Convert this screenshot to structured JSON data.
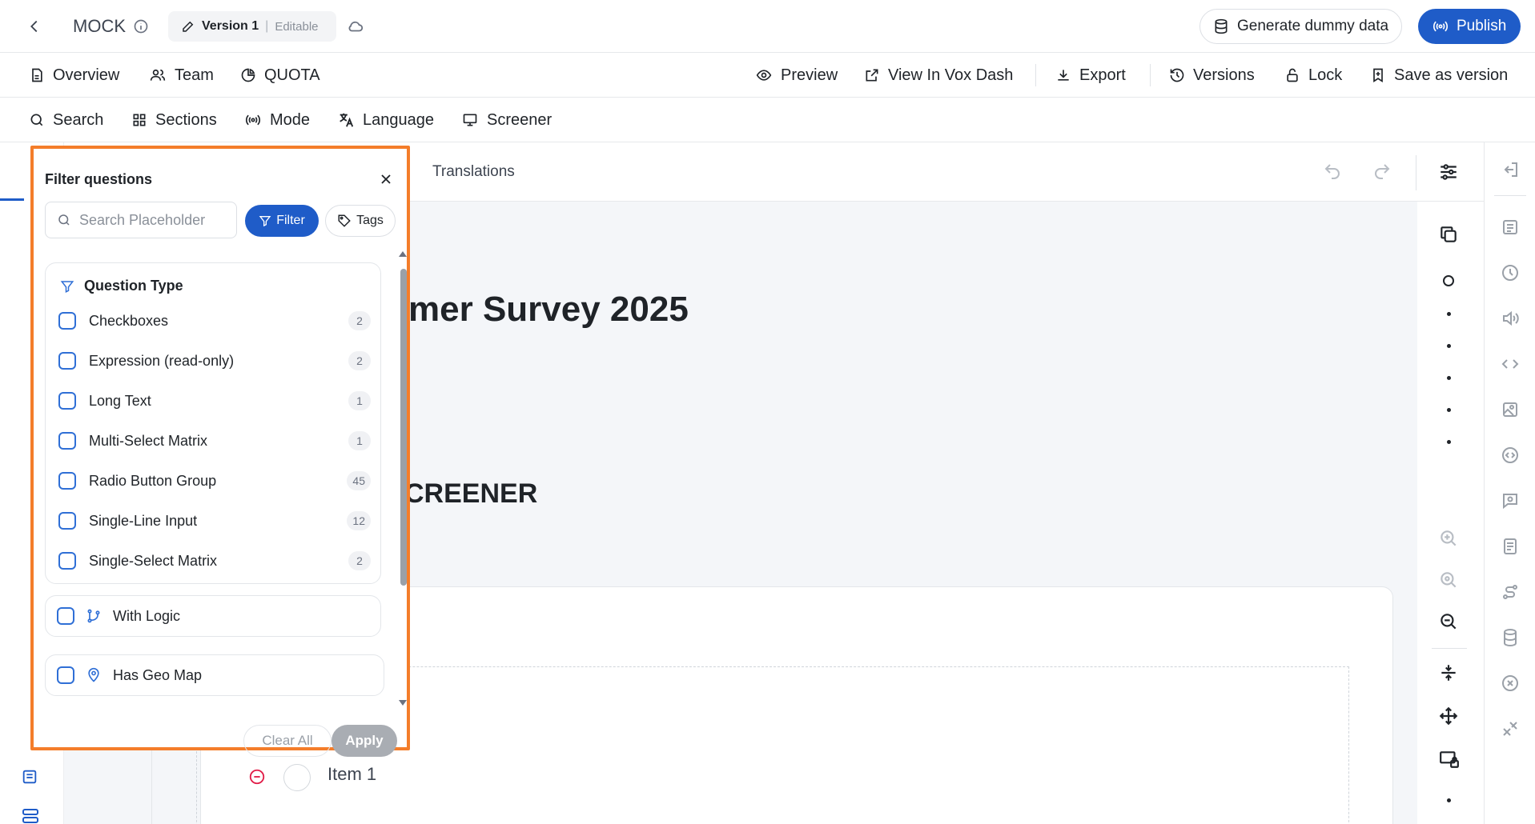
{
  "header": {
    "project_name": "MOCK",
    "version_label": "Version 1",
    "version_state": "Editable",
    "generate_label": "Generate dummy data",
    "publish_label": "Publish"
  },
  "nav_primary": {
    "overview": "Overview",
    "team": "Team",
    "quota": "QUOTA",
    "preview": "Preview",
    "view_in_vox_dash": "View In Vox Dash",
    "export": "Export",
    "versions": "Versions",
    "lock": "Lock",
    "save_as_version": "Save as version"
  },
  "nav_secondary": {
    "search": "Search",
    "sections": "Sections",
    "mode": "Mode",
    "language": "Language",
    "screener": "Screener"
  },
  "canvas": {
    "tab_translations": "Translations",
    "survey_title_fragment": "mer Survey 2025",
    "section_heading_fragment": "CREENER",
    "item_label": "Item 1"
  },
  "filter_panel": {
    "title": "Filter questions",
    "search_placeholder": "Search Placeholder",
    "filter_label": "Filter",
    "tags_label": "Tags",
    "group_title": "Question Type",
    "options": [
      {
        "label": "Checkboxes",
        "count": "2"
      },
      {
        "label": "Expression (read-only)",
        "count": "2"
      },
      {
        "label": "Long Text",
        "count": "1"
      },
      {
        "label": "Multi-Select Matrix",
        "count": "1"
      },
      {
        "label": "Radio Button Group",
        "count": "45"
      },
      {
        "label": "Single-Line Input",
        "count": "12"
      },
      {
        "label": "Single-Select Matrix",
        "count": "2"
      }
    ],
    "with_logic": "With Logic",
    "has_geo_map": "Has Geo Map",
    "clear_all": "Clear All",
    "apply": "Apply"
  },
  "colors": {
    "primary": "#1f5cc8",
    "highlight_border": "#f47d2a",
    "checkbox_border": "#2f6fd6"
  }
}
